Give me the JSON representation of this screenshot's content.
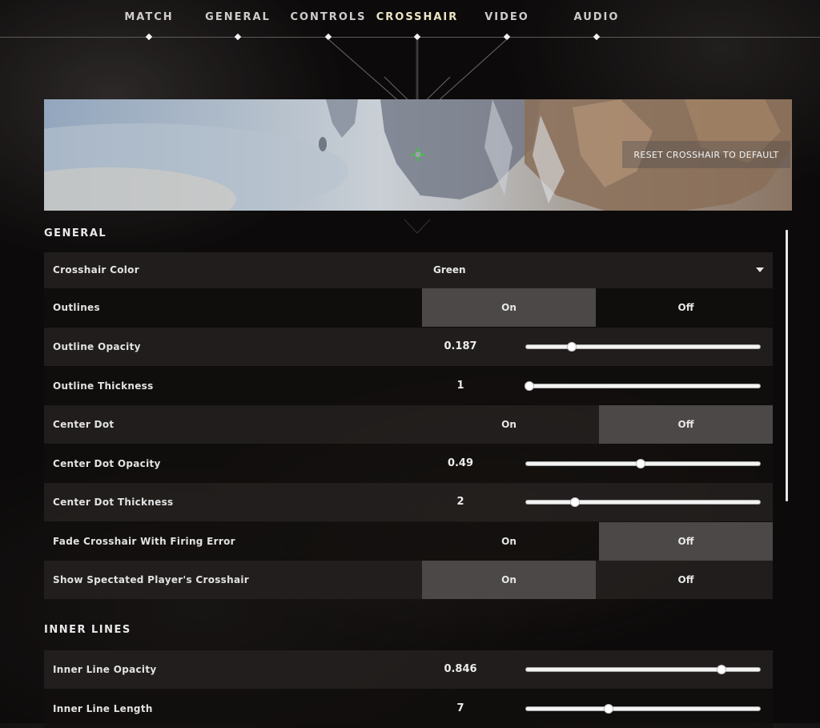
{
  "nav": {
    "tabs": [
      {
        "label": "MATCH"
      },
      {
        "label": "GENERAL"
      },
      {
        "label": "CONTROLS"
      },
      {
        "label": "CROSSHAIR",
        "active": true
      },
      {
        "label": "VIDEO"
      },
      {
        "label": "AUDIO"
      }
    ]
  },
  "preview": {
    "reset_label": "RESET CROSSHAIR TO DEFAULT",
    "crosshair_color": "#2fd02f"
  },
  "general": {
    "title": "GENERAL",
    "crosshair_color": {
      "label": "Crosshair Color",
      "value": "Green"
    },
    "outlines": {
      "label": "Outlines",
      "on": "On",
      "off": "Off",
      "selected": "on"
    },
    "outline_opacity": {
      "label": "Outline Opacity",
      "value": "0.187",
      "fraction": 0.187
    },
    "outline_thickness": {
      "label": "Outline Thickness",
      "value": "1",
      "fraction": 0.0
    },
    "center_dot": {
      "label": "Center Dot",
      "on": "On",
      "off": "Off",
      "selected": "off"
    },
    "center_dot_opacity": {
      "label": "Center Dot Opacity",
      "value": "0.49",
      "fraction": 0.49
    },
    "center_dot_thickness": {
      "label": "Center Dot Thickness",
      "value": "2",
      "fraction": 0.2
    },
    "fade_crosshair": {
      "label": "Fade Crosshair With Firing Error",
      "on": "On",
      "off": "Off",
      "selected": "off"
    },
    "show_spectated": {
      "label": "Show Spectated Player's Crosshair",
      "on": "On",
      "off": "Off",
      "selected": "on"
    }
  },
  "inner_lines": {
    "title": "INNER LINES",
    "inner_line_opacity": {
      "label": "Inner Line Opacity",
      "value": "0.846",
      "fraction": 0.846
    },
    "inner_line_length": {
      "label": "Inner Line Length",
      "value": "7",
      "fraction": 0.35
    }
  },
  "scrollbar": {
    "fraction_visible": 0.55
  }
}
